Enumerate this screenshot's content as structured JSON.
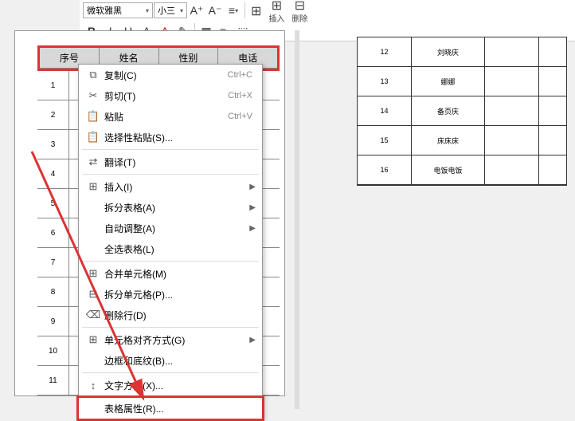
{
  "toolbar": {
    "fontname": "微软雅黑",
    "fontsize": "小三",
    "insert_label": "插入",
    "delete_label": "删除"
  },
  "headers": [
    "序号",
    "姓名",
    "性别",
    "电话"
  ],
  "rows": [
    "1",
    "2",
    "3",
    "4",
    "5",
    "6",
    "7",
    "8",
    "9",
    "10",
    "11"
  ],
  "right_rows": [
    {
      "n": "12",
      "name": "刘晓庆"
    },
    {
      "n": "13",
      "name": "娜娜"
    },
    {
      "n": "14",
      "name": "备页庆"
    },
    {
      "n": "15",
      "name": "床床床"
    },
    {
      "n": "16",
      "name": "电饭电饭"
    }
  ],
  "menu": {
    "copy": "复制(C)",
    "copy_sc": "Ctrl+C",
    "cut": "剪切(T)",
    "cut_sc": "Ctrl+X",
    "paste": "粘贴",
    "paste_sc": "Ctrl+V",
    "paste_special": "选择性粘贴(S)...",
    "translate": "翻译(T)",
    "insert": "插入(I)",
    "split_table": "拆分表格(A)",
    "autofit": "自动调整(A)",
    "select_table": "全选表格(L)",
    "merge": "合并单元格(M)",
    "split_cell": "拆分单元格(P)...",
    "delete_row": "删除行(D)",
    "align": "单元格对齐方式(G)",
    "borders": "边框和底纹(B)...",
    "text_dir": "文字方向(X)...",
    "table_props": "表格属性(R)..."
  }
}
